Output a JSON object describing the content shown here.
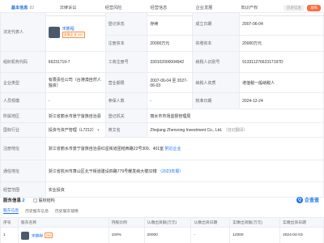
{
  "tabs": [
    {
      "label": "基本信息",
      "count": "82",
      "active": true
    },
    {
      "label": "法律诉讼",
      "count": "",
      "active": false
    },
    {
      "label": "经营风险",
      "count": "",
      "active": false
    },
    {
      "label": "经营信息",
      "count": "",
      "active": false
    },
    {
      "label": "企业发展",
      "count": "",
      "active": false
    },
    {
      "label": "知识产权",
      "count": "",
      "active": false
    }
  ],
  "tab_right": {
    "badge": "历史信息",
    "button": "发布"
  },
  "info": {
    "legal_rep_label": "法定代表人",
    "legal_rep_name": "宋鹏程",
    "legal_rep_assoc": "关联企业 200",
    "reg_status_label": "登记状态",
    "reg_status_value": "存续",
    "founded_label": "成立日期",
    "founded_value": "2007-06-04",
    "reg_capital_label": "注册资本",
    "reg_capital_value": "20000万元",
    "paid_capital_label": "实缴资本",
    "paid_capital_value": "20000万元",
    "org_code_label": "组织机构代码",
    "org_code_value": "66231719-7",
    "biz_reg_label": "工商注册号",
    "biz_reg_value": "330102000004942",
    "taxpayer_id_label": "纳税人识别号",
    "taxpayer_id_value": "91331127662317197D",
    "company_type_label": "企业类型",
    "company_type_value": "有限责任公司（台港澳自然人独资）",
    "biz_term_label": "营业期限",
    "biz_term_value": "2007-06-04 至 2027-06-03",
    "taxpayer_quality_label": "纳税人资质",
    "taxpayer_quality_value": "增值税一般纳税人",
    "staff_size_label": "人员规模",
    "staff_size_value": "-",
    "insured_label": "参保人数",
    "insured_value": "-",
    "approval_date_label": "核准日期",
    "approval_date_value": "2024-12-24",
    "region_label": "所属地区",
    "region_value": "浙江省丽水市景宁畲族自治县",
    "authority_label": "登记机关",
    "authority_value": "丽水市市场监督管理局",
    "industry_label": "国标行业",
    "industry_value": "投资与资产管理（L7212）",
    "english_name_label": "英文名",
    "english_name_value": "Zhejiang Zhenzong Investment Co., Ltd.",
    "english_name_note": "（自动翻译）",
    "reg_address_label": "注册地址",
    "reg_address_value": "浙江省丽水市景宁畲族自治县红星街道团结西路22号309、401室",
    "reg_address_link": "附近企业",
    "comm_address_label": "通信地址",
    "comm_address_value": "浙江省杭州市萧山区北干街道建设四路779号耀发纳大楼32楼",
    "comm_address_year": "（2023年报）",
    "scope_label": "经营范围",
    "scope_value": "实业投资"
  },
  "shareholders": {
    "title": "股东信息",
    "count": "2",
    "shareholding_chart": "股权结构",
    "subtabs": [
      "股东信息",
      "历史股东信息",
      "历史股东镜像"
    ],
    "logo": "企查查",
    "columns": [
      "序号",
      "股东名称",
      "持股比例",
      "认缴出资额(万元)",
      "认缴出资日期",
      "实缴出资额(万元)",
      "实缴出资日期"
    ],
    "rows": [
      {
        "index": "1",
        "name": "宋鹏程",
        "assoc": "200",
        "ratio": "100%",
        "sub_amount": "20000",
        "sub_date": "-",
        "paid_amount": "12000",
        "paid_date": "2024-04-03"
      }
    ]
  }
}
